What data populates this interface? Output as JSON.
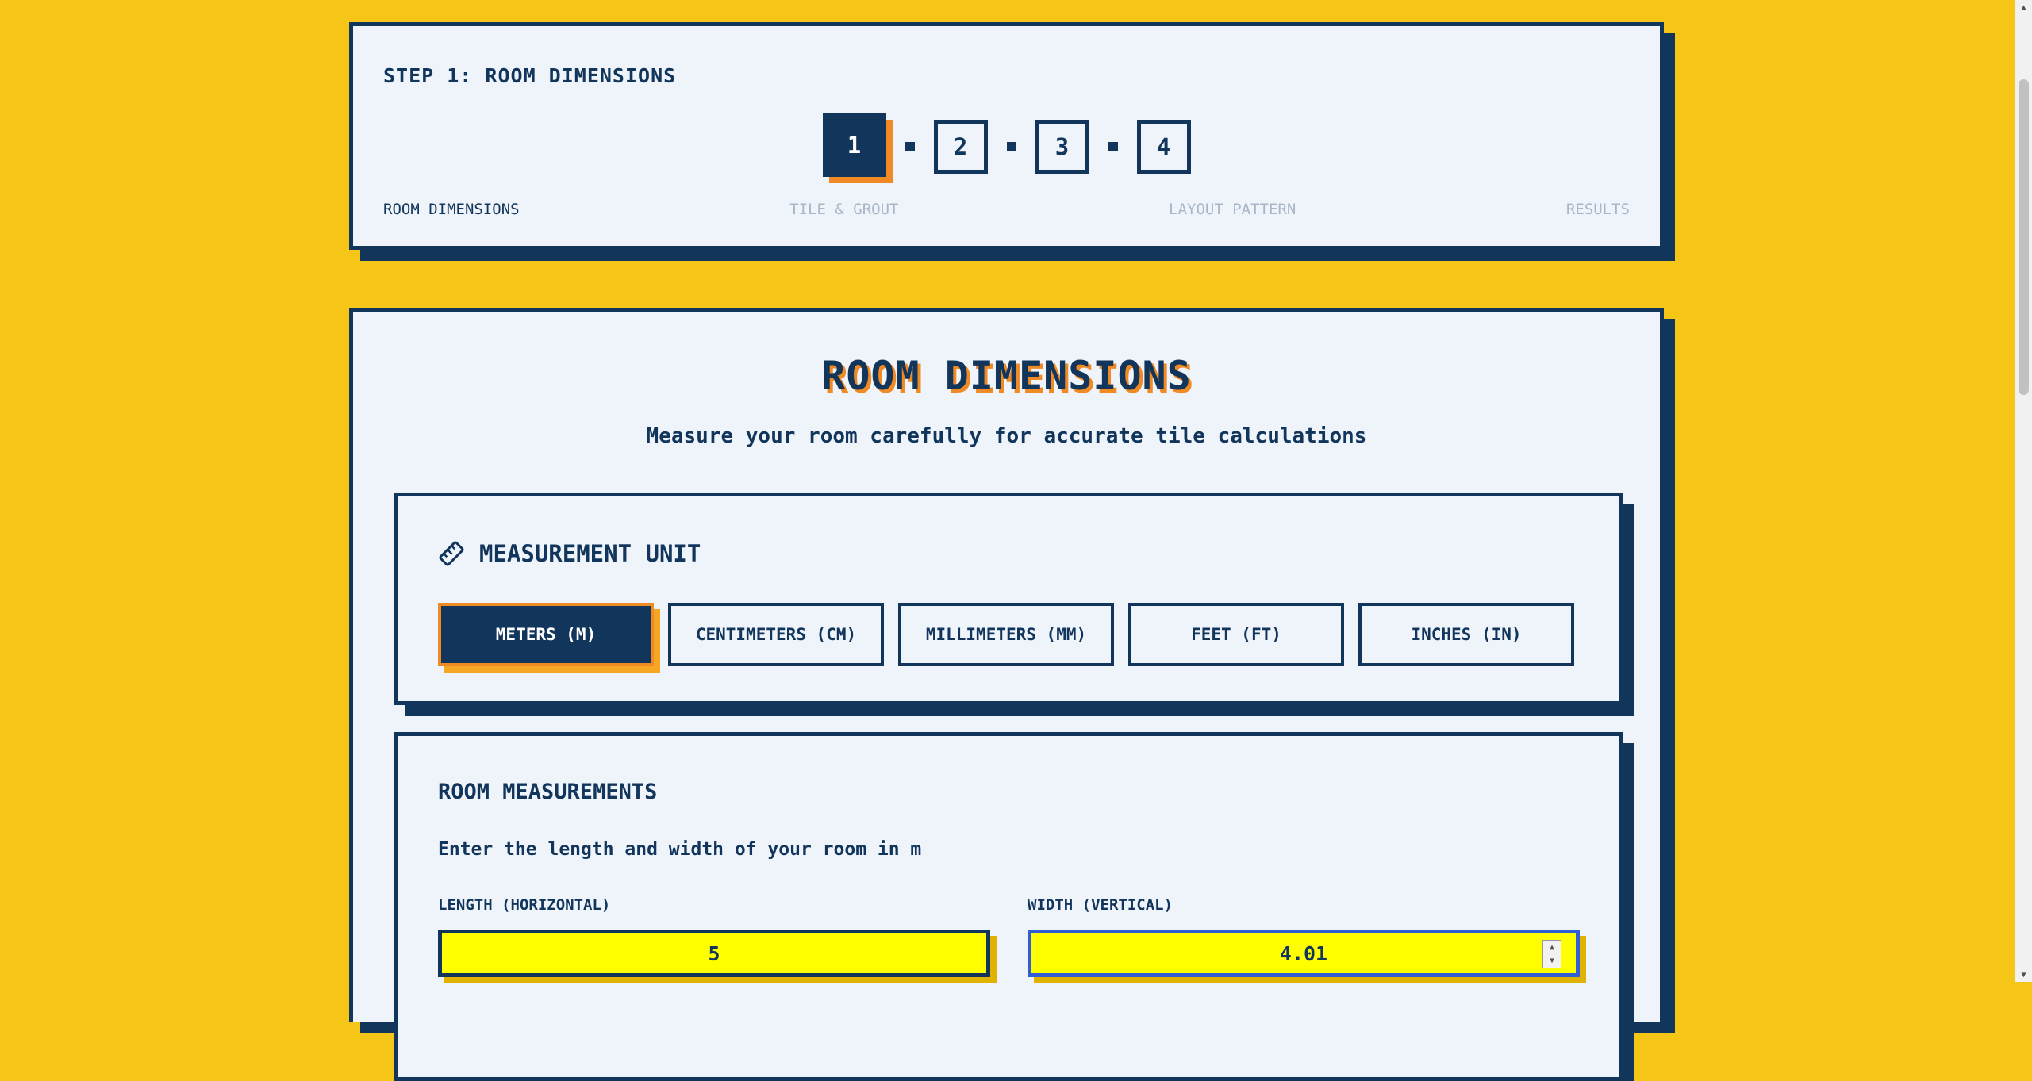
{
  "progress": {
    "heading": "STEP 1: ROOM DIMENSIONS",
    "steps": [
      "1",
      "2",
      "3",
      "4"
    ],
    "active_step": 1,
    "labels": [
      "ROOM DIMENSIONS",
      "TILE & GROUT",
      "LAYOUT PATTERN",
      "RESULTS"
    ]
  },
  "main": {
    "title": "ROOM DIMENSIONS",
    "subtitle": "Measure your room carefully for accurate tile calculations"
  },
  "units": {
    "heading": "MEASUREMENT UNIT",
    "icon": "ruler-icon",
    "options": [
      "METERS (M)",
      "CENTIMETERS (CM)",
      "MILLIMETERS (MM)",
      "FEET (FT)",
      "INCHES (IN)"
    ],
    "selected": "METERS (M)"
  },
  "measurements": {
    "heading": "ROOM MEASUREMENTS",
    "description": "Enter the length and width of your room in m",
    "length_label": "LENGTH (HORIZONTAL)",
    "length_value": "5",
    "width_label": "WIDTH (VERTICAL)",
    "width_value": "4.01"
  },
  "colors": {
    "background": "#f5c518",
    "navy": "#12355b",
    "accent": "#f08a24",
    "input": "#ffff00"
  }
}
